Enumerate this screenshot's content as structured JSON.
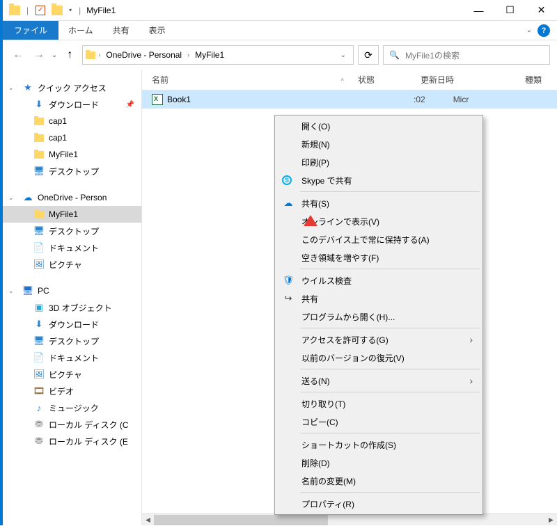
{
  "window": {
    "title": "MyFile1",
    "controls": {
      "min": "—",
      "max": "☐",
      "close": "✕"
    }
  },
  "ribbon": {
    "file": "ファイル",
    "tabs": [
      "ホーム",
      "共有",
      "表示"
    ]
  },
  "nav": {
    "back": "←",
    "fwd": "→",
    "up": "↑",
    "breadcrumbs": [
      "OneDrive - Personal",
      "MyFile1"
    ],
    "refresh": "⟳",
    "search_placeholder": "MyFile1の検索"
  },
  "columns": {
    "name": "名前",
    "status": "状態",
    "date": "更新日時",
    "type": "種類"
  },
  "file": {
    "name": "Book1",
    "date_visible": ":02",
    "type_visible": "Micr"
  },
  "navpane": {
    "quick": {
      "label": "クイック アクセス",
      "items": [
        "ダウンロード",
        "cap1",
        "cap1",
        "MyFile1",
        "デスクトップ"
      ]
    },
    "onedrive": {
      "label": "OneDrive - Person",
      "items": [
        "MyFile1",
        "デスクトップ",
        "ドキュメント",
        "ピクチャ"
      ]
    },
    "pc": {
      "label": "PC",
      "items": [
        "3D オブジェクト",
        "ダウンロード",
        "デスクトップ",
        "ドキュメント",
        "ピクチャ",
        "ビデオ",
        "ミュージック",
        "ローカル ディスク (C",
        "ローカル ディスク (E"
      ]
    }
  },
  "ctx": {
    "items": [
      "開く(O)",
      "新規(N)",
      "印刷(P)",
      "Skype で共有",
      "共有(S)",
      "オンラインで表示(V)",
      "このデバイス上で常に保持する(A)",
      "空き領域を増やす(F)",
      "ウイルス検査",
      "共有",
      "プログラムから開く(H)...",
      "アクセスを許可する(G)",
      "以前のバージョンの復元(V)",
      "送る(N)",
      "切り取り(T)",
      "コピー(C)",
      "ショートカットの作成(S)",
      "削除(D)",
      "名前の変更(M)",
      "プロパティ(R)"
    ]
  }
}
